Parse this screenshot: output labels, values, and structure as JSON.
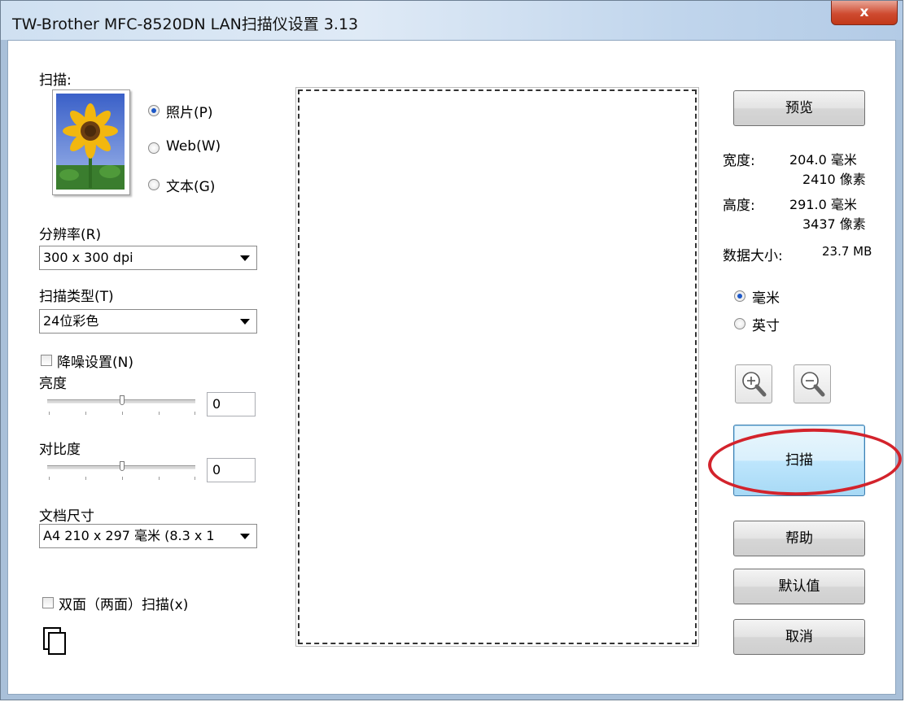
{
  "window": {
    "title": "TW-Brother MFC-8520DN LAN扫描仪设置   3.13",
    "close_glyph": "x"
  },
  "scan": {
    "label": "扫描:",
    "options": [
      {
        "label": "照片(P)",
        "selected": true
      },
      {
        "label": "Web(W)",
        "selected": false
      },
      {
        "label": "文本(G)",
        "selected": false
      }
    ]
  },
  "resolution": {
    "label": "分辨率(R)",
    "value": "300 x 300 dpi"
  },
  "scan_type": {
    "label": "扫描类型(T)",
    "value": "24位彩色"
  },
  "noise_reduction": {
    "label": "降噪设置(N)",
    "checked": false
  },
  "brightness": {
    "label": "亮度",
    "value": "0",
    "level": 0.5
  },
  "contrast": {
    "label": "对比度",
    "value": "0",
    "level": 0.5
  },
  "document_size": {
    "label": "文档尺寸",
    "value": "A4 210 x 297 毫米 (8.3 x 1"
  },
  "duplex": {
    "label": "双面（两面）扫描(x)",
    "checked": false
  },
  "buttons": {
    "preview": "预览",
    "scan": "扫描",
    "help": "帮助",
    "defaults": "默认值",
    "cancel": "取消"
  },
  "info": {
    "width_label": "宽度:",
    "width_mm": "204.0 毫米",
    "width_px": "2410 像素",
    "height_label": "高度:",
    "height_mm": "291.0 毫米",
    "height_px": "3437 像素",
    "size_label": "数据大小:",
    "size_value": "23.7 MB"
  },
  "units": [
    {
      "label": "毫米",
      "selected": true
    },
    {
      "label": "英寸",
      "selected": false
    }
  ],
  "icons": {
    "zoom_in": "zoom-in-icon",
    "zoom_out": "zoom-out-icon",
    "duplex": "duplex-pages-icon",
    "thumbnail": "sunflower-thumbnail"
  },
  "colors": {
    "highlight": "#d3232c",
    "radio_dot": "#1d58c7",
    "title_bar": "#cfe0f1"
  }
}
